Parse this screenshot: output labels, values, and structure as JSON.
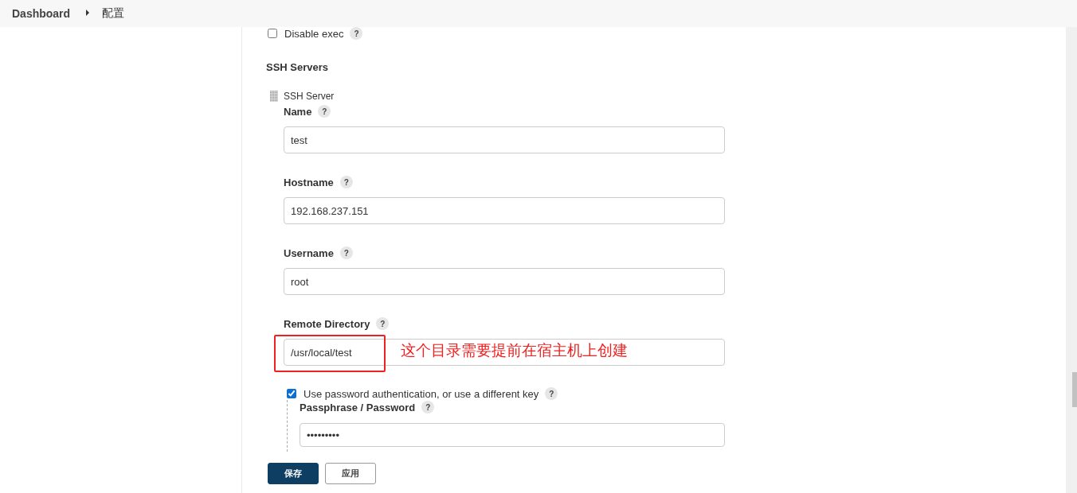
{
  "breadcrumb": [
    {
      "label": "Dashboard"
    },
    {
      "label": "配置"
    }
  ],
  "disable_exec": {
    "label": "Disable exec",
    "checked": false
  },
  "section_title": "SSH Servers",
  "server": {
    "title": "SSH Server",
    "fields": [
      {
        "label": "Name",
        "value": "test"
      },
      {
        "label": "Hostname",
        "value": "192.168.237.151"
      },
      {
        "label": "Username",
        "value": "root"
      },
      {
        "label": "Remote Directory",
        "value": "/usr/local/test",
        "annotated": true
      }
    ],
    "password_auth": {
      "label": "Use password authentication, or use a different key",
      "checked": true,
      "field_label": "Passphrase / Password",
      "value": "•••••••••"
    }
  },
  "annotation": {
    "text": "这个目录需要提前在宿主机上创建"
  },
  "help_mark": "?",
  "buttons": [
    {
      "label": "保存",
      "kind": "primary"
    },
    {
      "label": "应用",
      "kind": "secondary"
    }
  ]
}
